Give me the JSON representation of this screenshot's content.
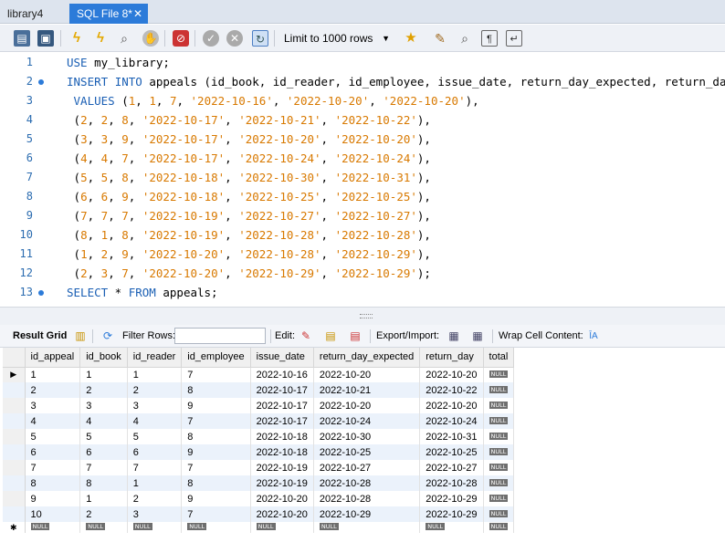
{
  "tabs": [
    {
      "label": "library4"
    },
    {
      "label": "SQL File 8*",
      "close": "✕"
    }
  ],
  "toolbar": {
    "limit_label": "Limit to 1000 rows"
  },
  "editor": {
    "lines": [
      {
        "n": "1",
        "code": "USE my_library;"
      },
      {
        "n": "2",
        "code": "INSERT INTO appeals (id_book, id_reader, id_employee, issue_date, return_day_expected, return_day)"
      },
      {
        "n": "3",
        "code": " VALUES (1, 1, 7, '2022-10-16', '2022-10-20', '2022-10-20'),"
      },
      {
        "n": "4",
        "code": " (2, 2, 8, '2022-10-17', '2022-10-21', '2022-10-22'),"
      },
      {
        "n": "5",
        "code": " (3, 3, 9, '2022-10-17', '2022-10-20', '2022-10-20'),"
      },
      {
        "n": "6",
        "code": " (4, 4, 7, '2022-10-17', '2022-10-24', '2022-10-24'),"
      },
      {
        "n": "7",
        "code": " (5, 5, 8, '2022-10-18', '2022-10-30', '2022-10-31'),"
      },
      {
        "n": "8",
        "code": " (6, 6, 9, '2022-10-18', '2022-10-25', '2022-10-25'),"
      },
      {
        "n": "9",
        "code": " (7, 7, 7, '2022-10-19', '2022-10-27', '2022-10-27'),"
      },
      {
        "n": "10",
        "code": " (8, 1, 8, '2022-10-19', '2022-10-28', '2022-10-28'),"
      },
      {
        "n": "11",
        "code": " (1, 2, 9, '2022-10-20', '2022-10-28', '2022-10-29'),"
      },
      {
        "n": "12",
        "code": " (2, 3, 7, '2022-10-20', '2022-10-29', '2022-10-29');"
      },
      {
        "n": "13",
        "code": "SELECT * FROM appeals;"
      }
    ]
  },
  "results_toolbar": {
    "result_grid": "Result Grid",
    "filter_rows": "Filter Rows:",
    "edit": "Edit:",
    "export_import": "Export/Import:",
    "wrap_cell": "Wrap Cell Content:"
  },
  "grid": {
    "columns": [
      "id_appeal",
      "id_book",
      "id_reader",
      "id_employee",
      "issue_date",
      "return_day_expected",
      "return_day",
      "total"
    ],
    "null_label": "NULL",
    "rows": [
      [
        "1",
        "1",
        "1",
        "7",
        "2022-10-16",
        "2022-10-20",
        "2022-10-20"
      ],
      [
        "2",
        "2",
        "2",
        "8",
        "2022-10-17",
        "2022-10-21",
        "2022-10-22"
      ],
      [
        "3",
        "3",
        "3",
        "9",
        "2022-10-17",
        "2022-10-20",
        "2022-10-20"
      ],
      [
        "4",
        "4",
        "4",
        "7",
        "2022-10-17",
        "2022-10-24",
        "2022-10-24"
      ],
      [
        "5",
        "5",
        "5",
        "8",
        "2022-10-18",
        "2022-10-30",
        "2022-10-31"
      ],
      [
        "6",
        "6",
        "6",
        "9",
        "2022-10-18",
        "2022-10-25",
        "2022-10-25"
      ],
      [
        "7",
        "7",
        "7",
        "7",
        "2022-10-19",
        "2022-10-27",
        "2022-10-27"
      ],
      [
        "8",
        "8",
        "1",
        "8",
        "2022-10-19",
        "2022-10-28",
        "2022-10-28"
      ],
      [
        "9",
        "1",
        "2",
        "9",
        "2022-10-20",
        "2022-10-28",
        "2022-10-29"
      ],
      [
        "10",
        "2",
        "3",
        "7",
        "2022-10-20",
        "2022-10-29",
        "2022-10-29"
      ]
    ]
  }
}
